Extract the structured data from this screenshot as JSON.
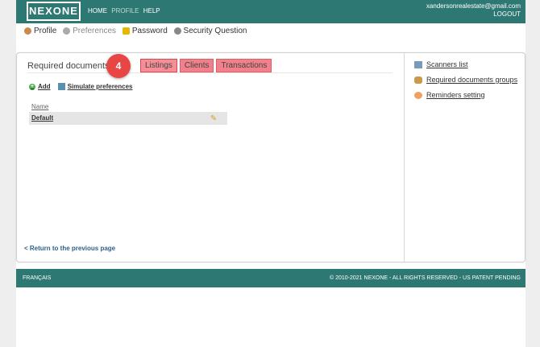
{
  "header": {
    "logo": "NEXONE",
    "nav": [
      "HOME",
      "PROFILE",
      "HELP"
    ],
    "user_email": "xandersonrealestate@gmail.com",
    "logout": "LOGOUT"
  },
  "submenu": [
    "Profile",
    "Preferences",
    "Password",
    "Security Question"
  ],
  "panel": {
    "title": "Required documents",
    "title_tail": "s",
    "badge": "4",
    "tabs": [
      "Listings",
      "Clients",
      "Transactions"
    ],
    "actions": {
      "add": "Add",
      "simulate": "Simulate preferences"
    },
    "table": {
      "header": "Name",
      "rows": [
        "Default"
      ]
    },
    "back_link": "< Return to the previous page"
  },
  "sidebar": [
    "Scanners list",
    "Required documents groups",
    "Reminders setting"
  ],
  "footer": {
    "language": "FRANÇAIS",
    "copyright": "© 2010-2021 NEXONE - ALL RIGHTS RESERVED - US PATENT PENDING"
  },
  "colors": {
    "brand_teal": "#2e7873",
    "tab_red": "#f0818a",
    "badge_red": "#e84545"
  }
}
